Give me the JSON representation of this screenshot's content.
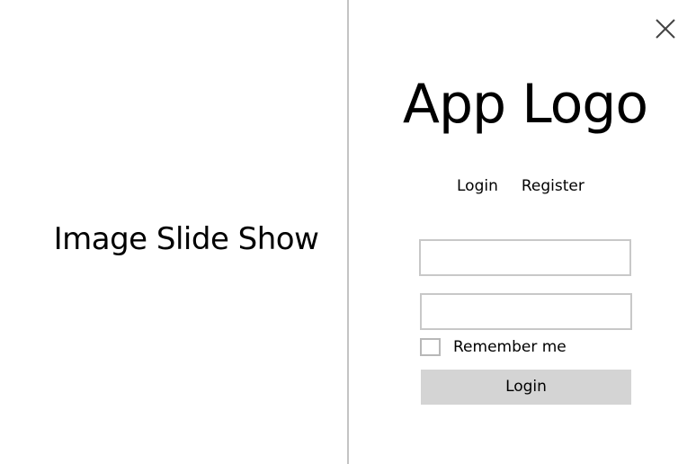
{
  "left_pane": {
    "slideshow_label": "Image Slide Show"
  },
  "right_pane": {
    "close_icon": "close-icon",
    "app_logo": "App Logo",
    "tabs": [
      {
        "label": "Login"
      },
      {
        "label": "Register"
      }
    ],
    "username": {
      "value": "",
      "placeholder": ""
    },
    "password": {
      "value": "",
      "placeholder": ""
    },
    "remember_me": {
      "label": "Remember me",
      "checked": false
    },
    "login_button": {
      "label": "Login"
    }
  },
  "colors": {
    "divider": "#c4c4c4",
    "input_border": "#c8c8c8",
    "button_background": "#d4d4d4"
  }
}
